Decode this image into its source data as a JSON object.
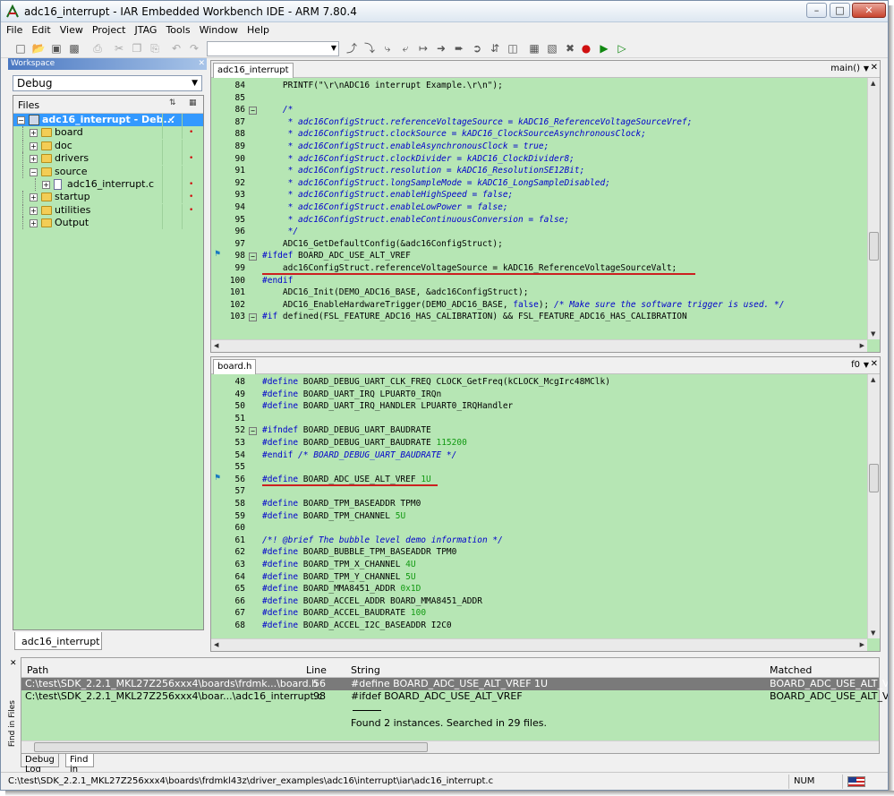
{
  "window": {
    "title": "adc16_interrupt - IAR Embedded Workbench IDE - ARM 7.80.4",
    "minimize": "–",
    "maximize": "□",
    "close": "✕"
  },
  "menu": [
    "File",
    "Edit",
    "View",
    "Project",
    "JTAG",
    "Tools",
    "Window",
    "Help"
  ],
  "workspace": {
    "title": "Workspace",
    "config": "Debug",
    "files_header": "Files",
    "tab": "adc16_interrupt",
    "tree": [
      {
        "label": "adc16_interrupt - Deb...",
        "level": 0,
        "type": "project",
        "expanded": true,
        "selected": true,
        "checked": true,
        "modified": false
      },
      {
        "label": "board",
        "level": 1,
        "type": "folder",
        "expanded": false,
        "modified": true
      },
      {
        "label": "doc",
        "level": 1,
        "type": "folder",
        "expanded": false,
        "modified": false
      },
      {
        "label": "drivers",
        "level": 1,
        "type": "folder",
        "expanded": false,
        "modified": true
      },
      {
        "label": "source",
        "level": 1,
        "type": "folder",
        "expanded": true,
        "modified": false
      },
      {
        "label": "adc16_interrupt.c",
        "level": 2,
        "type": "file",
        "expanded": false,
        "modified": true
      },
      {
        "label": "startup",
        "level": 1,
        "type": "folder",
        "expanded": false,
        "modified": true
      },
      {
        "label": "utilities",
        "level": 1,
        "type": "folder",
        "expanded": false,
        "modified": true
      },
      {
        "label": "Output",
        "level": 1,
        "type": "folder",
        "expanded": false,
        "modified": false
      }
    ]
  },
  "editor_top": {
    "tab": "adc16_interrupt",
    "function": "main()",
    "lines": [
      {
        "n": "84",
        "segs": [
          [
            "    PRINTF(\"\\r\\nADC16 interrupt Example.\\r\\n\");",
            ""
          ]
        ]
      },
      {
        "n": "85",
        "segs": [
          [
            "",
            ""
          ]
        ]
      },
      {
        "n": "86",
        "fold": "−",
        "segs": [
          [
            "    /*",
            "cm"
          ]
        ]
      },
      {
        "n": "87",
        "segs": [
          [
            "     * adc16ConfigStruct.referenceVoltageSource = kADC16_ReferenceVoltageSourceVref;",
            "cm"
          ]
        ]
      },
      {
        "n": "88",
        "segs": [
          [
            "     * adc16ConfigStruct.clockSource = kADC16_ClockSourceAsynchronousClock;",
            "cm"
          ]
        ]
      },
      {
        "n": "89",
        "segs": [
          [
            "     * adc16ConfigStruct.enableAsynchronousClock = true;",
            "cm"
          ]
        ]
      },
      {
        "n": "90",
        "segs": [
          [
            "     * adc16ConfigStruct.clockDivider = kADC16_ClockDivider8;",
            "cm"
          ]
        ]
      },
      {
        "n": "91",
        "segs": [
          [
            "     * adc16ConfigStruct.resolution = kADC16_ResolutionSE12Bit;",
            "cm"
          ]
        ]
      },
      {
        "n": "92",
        "segs": [
          [
            "     * adc16ConfigStruct.longSampleMode = kADC16_LongSampleDisabled;",
            "cm"
          ]
        ]
      },
      {
        "n": "93",
        "segs": [
          [
            "     * adc16ConfigStruct.enableHighSpeed = false;",
            "cm"
          ]
        ]
      },
      {
        "n": "94",
        "segs": [
          [
            "     * adc16ConfigStruct.enableLowPower = false;",
            "cm"
          ]
        ]
      },
      {
        "n": "95",
        "segs": [
          [
            "     * adc16ConfigStruct.enableContinuousConversion = false;",
            "cm"
          ]
        ]
      },
      {
        "n": "96",
        "segs": [
          [
            "     */",
            "cm"
          ]
        ]
      },
      {
        "n": "97",
        "segs": [
          [
            "    ADC16_GetDefaultConfig(&adc16ConfigStruct);",
            ""
          ]
        ]
      },
      {
        "n": "98",
        "fold": "−",
        "bookmark": true,
        "segs": [
          [
            "#ifdef",
            "kw"
          ],
          [
            " BOARD_ADC_USE_ALT_VREF",
            ""
          ]
        ]
      },
      {
        "n": "99",
        "underline": true,
        "segs": [
          [
            "    adc16ConfigStruct.referenceVoltageSource = kADC16_ReferenceVoltageSourceValt;",
            ""
          ]
        ]
      },
      {
        "n": "100",
        "segs": [
          [
            "#endif",
            "kw"
          ]
        ]
      },
      {
        "n": "101",
        "segs": [
          [
            "    ADC16_Init(DEMO_ADC16_BASE, &adc16ConfigStruct);",
            ""
          ]
        ]
      },
      {
        "n": "102",
        "segs": [
          [
            "    ADC16_EnableHardwareTrigger(DEMO_ADC16_BASE, ",
            ""
          ],
          [
            "false",
            "kw"
          ],
          [
            "); ",
            ""
          ],
          [
            "/* Make sure the software trigger is used. */",
            "cm"
          ]
        ]
      },
      {
        "n": "103",
        "fold": "−",
        "segs": [
          [
            "#if",
            "kw"
          ],
          [
            " defined(FSL_FEATURE_ADC16_HAS_CALIBRATION) && FSL_FEATURE_ADC16_HAS_CALIBRATION",
            ""
          ]
        ]
      }
    ]
  },
  "editor_bottom": {
    "tab": "board.h",
    "function": "f0",
    "lines": [
      {
        "n": "48",
        "segs": [
          [
            "#define",
            "kw"
          ],
          [
            " BOARD_DEBUG_UART_CLK_FREQ CLOCK_GetFreq(kCLOCK_McgIrc48MClk)",
            ""
          ]
        ]
      },
      {
        "n": "49",
        "segs": [
          [
            "#define",
            "kw"
          ],
          [
            " BOARD_UART_IRQ LPUART0_IRQn",
            ""
          ]
        ]
      },
      {
        "n": "50",
        "segs": [
          [
            "#define",
            "kw"
          ],
          [
            " BOARD_UART_IRQ_HANDLER LPUART0_IRQHandler",
            ""
          ]
        ]
      },
      {
        "n": "51",
        "segs": [
          [
            "",
            ""
          ]
        ]
      },
      {
        "n": "52",
        "fold": "−",
        "segs": [
          [
            "#ifndef",
            "kw"
          ],
          [
            " BOARD_DEBUG_UART_BAUDRATE",
            ""
          ]
        ]
      },
      {
        "n": "53",
        "segs": [
          [
            "#define",
            "kw"
          ],
          [
            " BOARD_DEBUG_UART_BAUDRATE ",
            ""
          ],
          [
            "115200",
            "nm"
          ]
        ]
      },
      {
        "n": "54",
        "segs": [
          [
            "#endif",
            "kw"
          ],
          [
            " /* BOARD_DEBUG_UART_BAUDRATE */",
            "cm"
          ]
        ]
      },
      {
        "n": "55",
        "segs": [
          [
            "",
            ""
          ]
        ]
      },
      {
        "n": "56",
        "bookmark": true,
        "underline": true,
        "segs": [
          [
            "#define",
            "kw"
          ],
          [
            " BOARD_ADC_USE_ALT_VREF ",
            ""
          ],
          [
            "1U",
            "nm"
          ]
        ]
      },
      {
        "n": "57",
        "segs": [
          [
            "",
            ""
          ]
        ]
      },
      {
        "n": "58",
        "segs": [
          [
            "#define",
            "kw"
          ],
          [
            " BOARD_TPM_BASEADDR TPM0",
            ""
          ]
        ]
      },
      {
        "n": "59",
        "segs": [
          [
            "#define",
            "kw"
          ],
          [
            " BOARD_TPM_CHANNEL ",
            ""
          ],
          [
            "5U",
            "nm"
          ]
        ]
      },
      {
        "n": "60",
        "segs": [
          [
            "",
            ""
          ]
        ]
      },
      {
        "n": "61",
        "segs": [
          [
            "/*! @brief The bubble level demo information */",
            "cm"
          ]
        ]
      },
      {
        "n": "62",
        "segs": [
          [
            "#define",
            "kw"
          ],
          [
            " BOARD_BUBBLE_TPM_BASEADDR TPM0",
            ""
          ]
        ]
      },
      {
        "n": "63",
        "segs": [
          [
            "#define",
            "kw"
          ],
          [
            " BOARD_TPM_X_CHANNEL ",
            ""
          ],
          [
            "4U",
            "nm"
          ]
        ]
      },
      {
        "n": "64",
        "segs": [
          [
            "#define",
            "kw"
          ],
          [
            " BOARD_TPM_Y_CHANNEL ",
            ""
          ],
          [
            "5U",
            "nm"
          ]
        ]
      },
      {
        "n": "65",
        "segs": [
          [
            "#define",
            "kw"
          ],
          [
            " BOARD_MMA8451_ADDR ",
            ""
          ],
          [
            "0x1D",
            "nm"
          ]
        ]
      },
      {
        "n": "66",
        "segs": [
          [
            "#define",
            "kw"
          ],
          [
            " BOARD_ACCEL_ADDR BOARD_MMA8451_ADDR",
            ""
          ]
        ]
      },
      {
        "n": "67",
        "segs": [
          [
            "#define",
            "kw"
          ],
          [
            " BOARD_ACCEL_BAUDRATE ",
            ""
          ],
          [
            "100",
            "nm"
          ]
        ]
      },
      {
        "n": "68",
        "segs": [
          [
            "#define",
            "kw"
          ],
          [
            " BOARD_ACCEL_I2C_BASEADDR I2C0",
            ""
          ]
        ]
      }
    ]
  },
  "find_results": {
    "panel_label": "Find in Files",
    "headers": {
      "path": "Path",
      "line": "Line",
      "string": "String",
      "matched": "Matched"
    },
    "rows": [
      {
        "path": "C:\\test\\SDK_2.2.1_MKL27Z256xxx4\\boards\\frdmk...\\board.h",
        "line": "56",
        "string": "#define BOARD_ADC_USE_ALT_VREF 1U",
        "matched": "BOARD_ADC_USE_ALT_VREF",
        "selected": true
      },
      {
        "path": "C:\\test\\SDK_2.2.1_MKL27Z256xxx4\\boar...\\adc16_interrupt.c",
        "line": "98",
        "string": "#ifdef BOARD_ADC_USE_ALT_VREF",
        "matched": "BOARD_ADC_USE_ALT_VREF",
        "selected": false
      }
    ],
    "summary": "Found 2 instances. Searched in 29 files.",
    "tabs": [
      "Debug Log",
      "Find in Files"
    ]
  },
  "statusbar": {
    "path": "C:\\test\\SDK_2.2.1_MKL27Z256xxx4\\boards\\frdmkl43z\\driver_examples\\adc16\\interrupt\\iar\\adc16_interrupt.c",
    "num": "NUM"
  },
  "colors": {
    "editor_bg": "#b6e6b4",
    "selection": "#3399ff",
    "keyword": "#0000cc",
    "number": "#119911",
    "underline": "#cc2020"
  }
}
